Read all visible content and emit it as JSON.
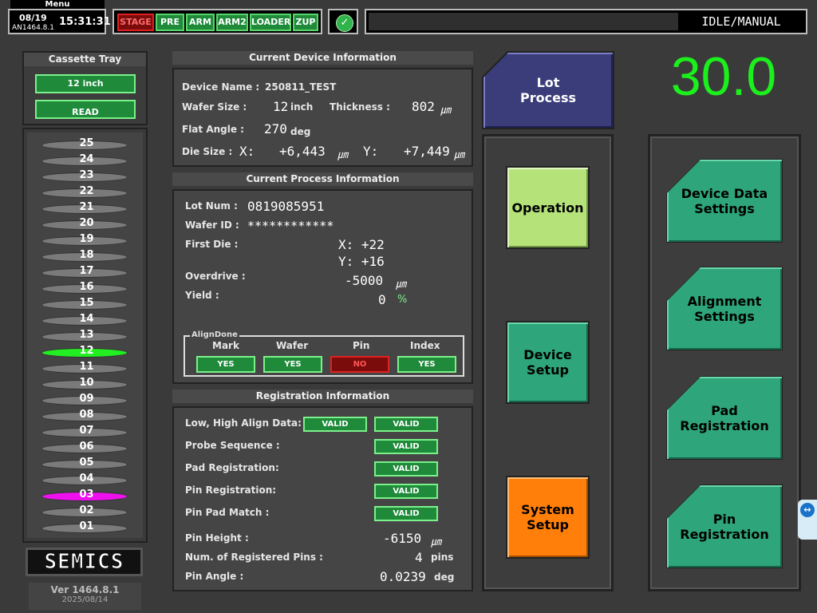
{
  "topbar": {
    "menu_label": "Menu",
    "date": "08/19",
    "time": "15:31:31",
    "version_code": "AN1464.8.1",
    "status_buttons": [
      "STAGE",
      "PRE",
      "ARM",
      "ARM2",
      "LOADER",
      "ZUP"
    ],
    "status_colors": {
      "STAGE": "#e02020",
      "others": "#59d46a"
    },
    "ok_icon": "check-circle-icon",
    "mode": "IDLE/MANUAL"
  },
  "cassette": {
    "title": "Cassette Tray",
    "size_button": "12 inch",
    "read_button": "READ",
    "slots": [
      "25",
      "24",
      "23",
      "22",
      "21",
      "20",
      "19",
      "18",
      "17",
      "16",
      "15",
      "14",
      "13",
      "12",
      "11",
      "10",
      "09",
      "08",
      "07",
      "06",
      "05",
      "04",
      "03",
      "02",
      "01"
    ],
    "active_slot": "12",
    "active_color": "#22ee22",
    "marked_slot": "03",
    "marked_color": "#ee11ee",
    "logo": "SEMICS",
    "version": "Ver 1464.8.1",
    "version_date": "2025/08/14"
  },
  "device_info": {
    "title": "Current Device Information",
    "device_name_label": "Device Name :",
    "device_name": "250811_TEST",
    "wafer_size_label": "Wafer Size :",
    "wafer_size": "12",
    "wafer_size_unit": "inch",
    "thickness_label": "Thickness :",
    "thickness": "802",
    "thickness_unit": "㎛",
    "flat_angle_label": "Flat Angle :",
    "flat_angle": "270",
    "flat_angle_unit": "deg",
    "die_size_label": "Die Size :",
    "die_x_label": "X:",
    "die_x": "+6,443",
    "die_x_unit": "㎛",
    "die_y_label": "Y:",
    "die_y": "+7,449",
    "die_y_unit": "㎛"
  },
  "process_info": {
    "title": "Current  Process Information",
    "lot_num_label": "Lot Num :",
    "lot_num": "0819085951",
    "wafer_id_label": "Wafer ID :",
    "wafer_id": "************",
    "first_die_label": "First Die :",
    "first_die_x": "X: +22",
    "first_die_y": "Y: +16",
    "overdrive_label": "Overdrive :",
    "overdrive": "-5000",
    "overdrive_unit": "㎛",
    "yield_label": "Yield :",
    "yield": "0",
    "yield_unit": "%",
    "align_title": "AlignDone",
    "align_items": [
      {
        "label": "Mark",
        "status": "YES"
      },
      {
        "label": "Wafer",
        "status": "YES"
      },
      {
        "label": "Pin",
        "status": "NO"
      },
      {
        "label": "Index",
        "status": "YES"
      }
    ]
  },
  "registration_info": {
    "title": "Registration  Information",
    "low_high_label": "Low, High Align Data:",
    "low_status": "VALID",
    "high_status": "VALID",
    "probe_seq_label": "Probe Sequence :",
    "probe_seq_status": "VALID",
    "pad_reg_label": "Pad Registration:",
    "pad_reg_status": "VALID",
    "pin_reg_label": "Pin Registration:",
    "pin_reg_status": "VALID",
    "pin_pad_label": "Pin Pad Match :",
    "pin_pad_status": "VALID",
    "pin_height_label": "Pin Height :",
    "pin_height": "-6150",
    "pin_height_unit": "㎛",
    "num_pins_label": "Num. of Registered Pins :",
    "num_pins": "4",
    "num_pins_unit": "pins",
    "pin_angle_label": "Pin Angle :",
    "pin_angle": "0.0239",
    "pin_angle_unit": "deg"
  },
  "center_buttons": {
    "lot_process": "Lot\nProcess",
    "operation": "Operation",
    "device_setup": "Device\nSetup",
    "system_setup": "System\nSetup"
  },
  "big_value": "30.0",
  "right_buttons": {
    "device_data": "Device Data\nSettings",
    "alignment": "Alignment\nSettings",
    "pad_reg": "Pad\nRegistration",
    "pin_reg": "Pin\nRegistration"
  }
}
